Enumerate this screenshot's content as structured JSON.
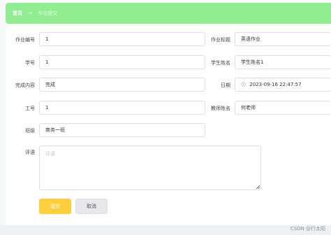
{
  "breadcrumb": {
    "home": "首页",
    "separator": "→",
    "current": "作业提交"
  },
  "form": {
    "homework_id": {
      "label": "作业编号",
      "value": "1"
    },
    "homework_title": {
      "label": "作业标题",
      "value": "英语作业"
    },
    "student_id": {
      "label": "学号",
      "value": "1"
    },
    "student_name": {
      "label": "学生姓名",
      "value": "学生姓名1"
    },
    "completion": {
      "label": "完成内容",
      "value": "完成"
    },
    "date": {
      "label": "日期",
      "value": "2023-09-16 22:47:57"
    },
    "work_id": {
      "label": "工号",
      "value": "1"
    },
    "teacher_name": {
      "label": "教师姓名",
      "value": "何老师"
    },
    "class": {
      "label": "班级",
      "value": "商务一班"
    },
    "comment": {
      "label": "评语",
      "placeholder": "评语"
    }
  },
  "buttons": {
    "submit": "提交",
    "cancel": "取消"
  },
  "watermark": "CSDN @行太阳",
  "colors": {
    "header_bg": "#90ee90",
    "submit_bg": "#fdcf3b",
    "cancel_bg": "#e8e8ea"
  },
  "icons": {
    "date": "clock-icon"
  }
}
